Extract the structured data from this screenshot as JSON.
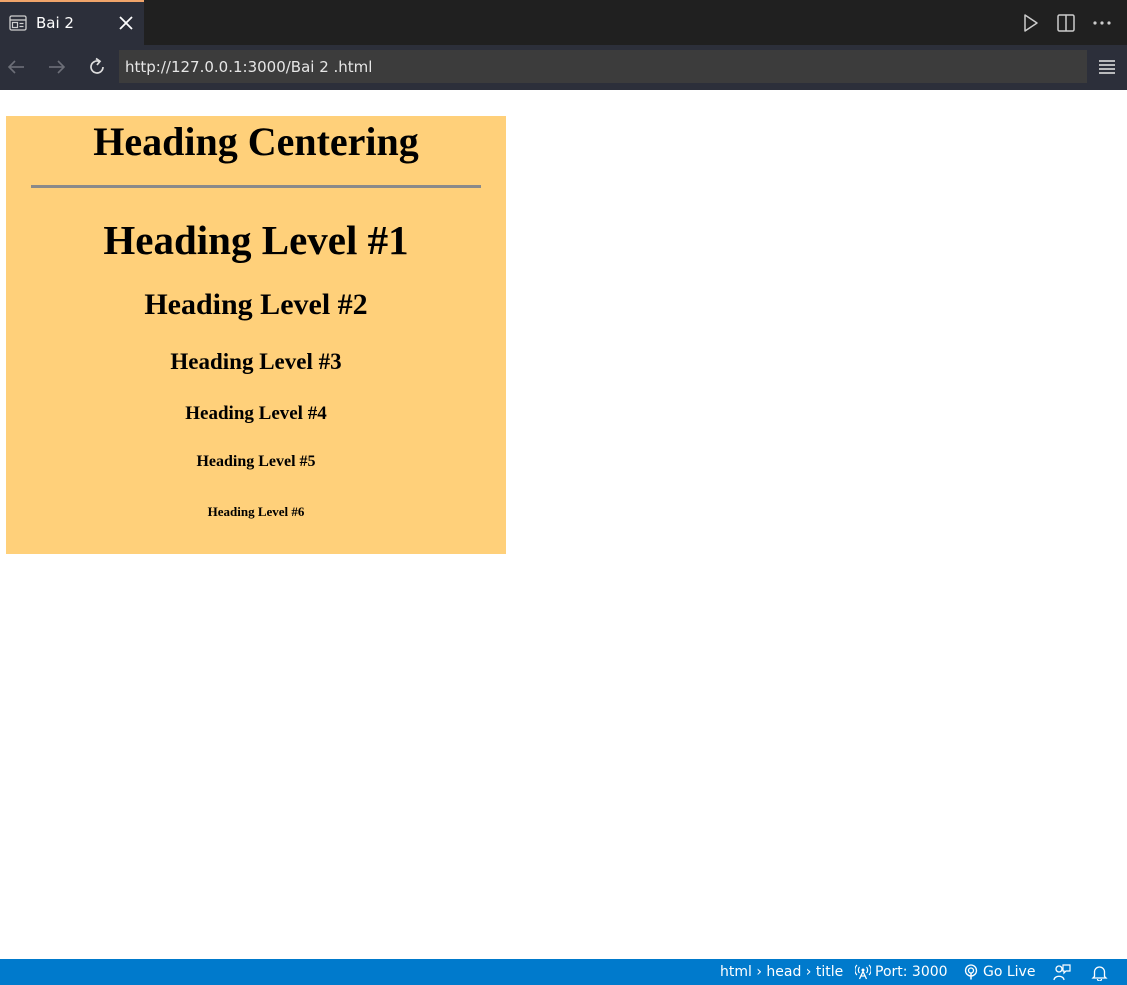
{
  "tab": {
    "title": "Bai 2"
  },
  "address_bar": {
    "url": "http://127.0.0.1:3000/Bai 2 .html"
  },
  "page": {
    "heading_centering": "Heading Centering",
    "headings": [
      "Heading Level #1",
      "Heading Level #2",
      "Heading Level #3",
      "Heading Level #4",
      "Heading Level #5",
      "Heading Level #6"
    ],
    "background_color": "#ffd07a"
  },
  "statusbar": {
    "breadcrumb": "html › head › title",
    "port": "Port: 3000",
    "go_live": "Go Live"
  },
  "colors": {
    "tab_accent": "#f0a46a",
    "statusbar": "#007acc"
  },
  "icons": [
    "preview-tab-icon",
    "close-icon",
    "run-icon",
    "split-editor-icon",
    "more-icon",
    "back-arrow-icon",
    "forward-arrow-icon",
    "reload-icon",
    "menu-icon",
    "broadcast-icon",
    "go-live-icon",
    "feedback-icon",
    "bell-icon"
  ]
}
